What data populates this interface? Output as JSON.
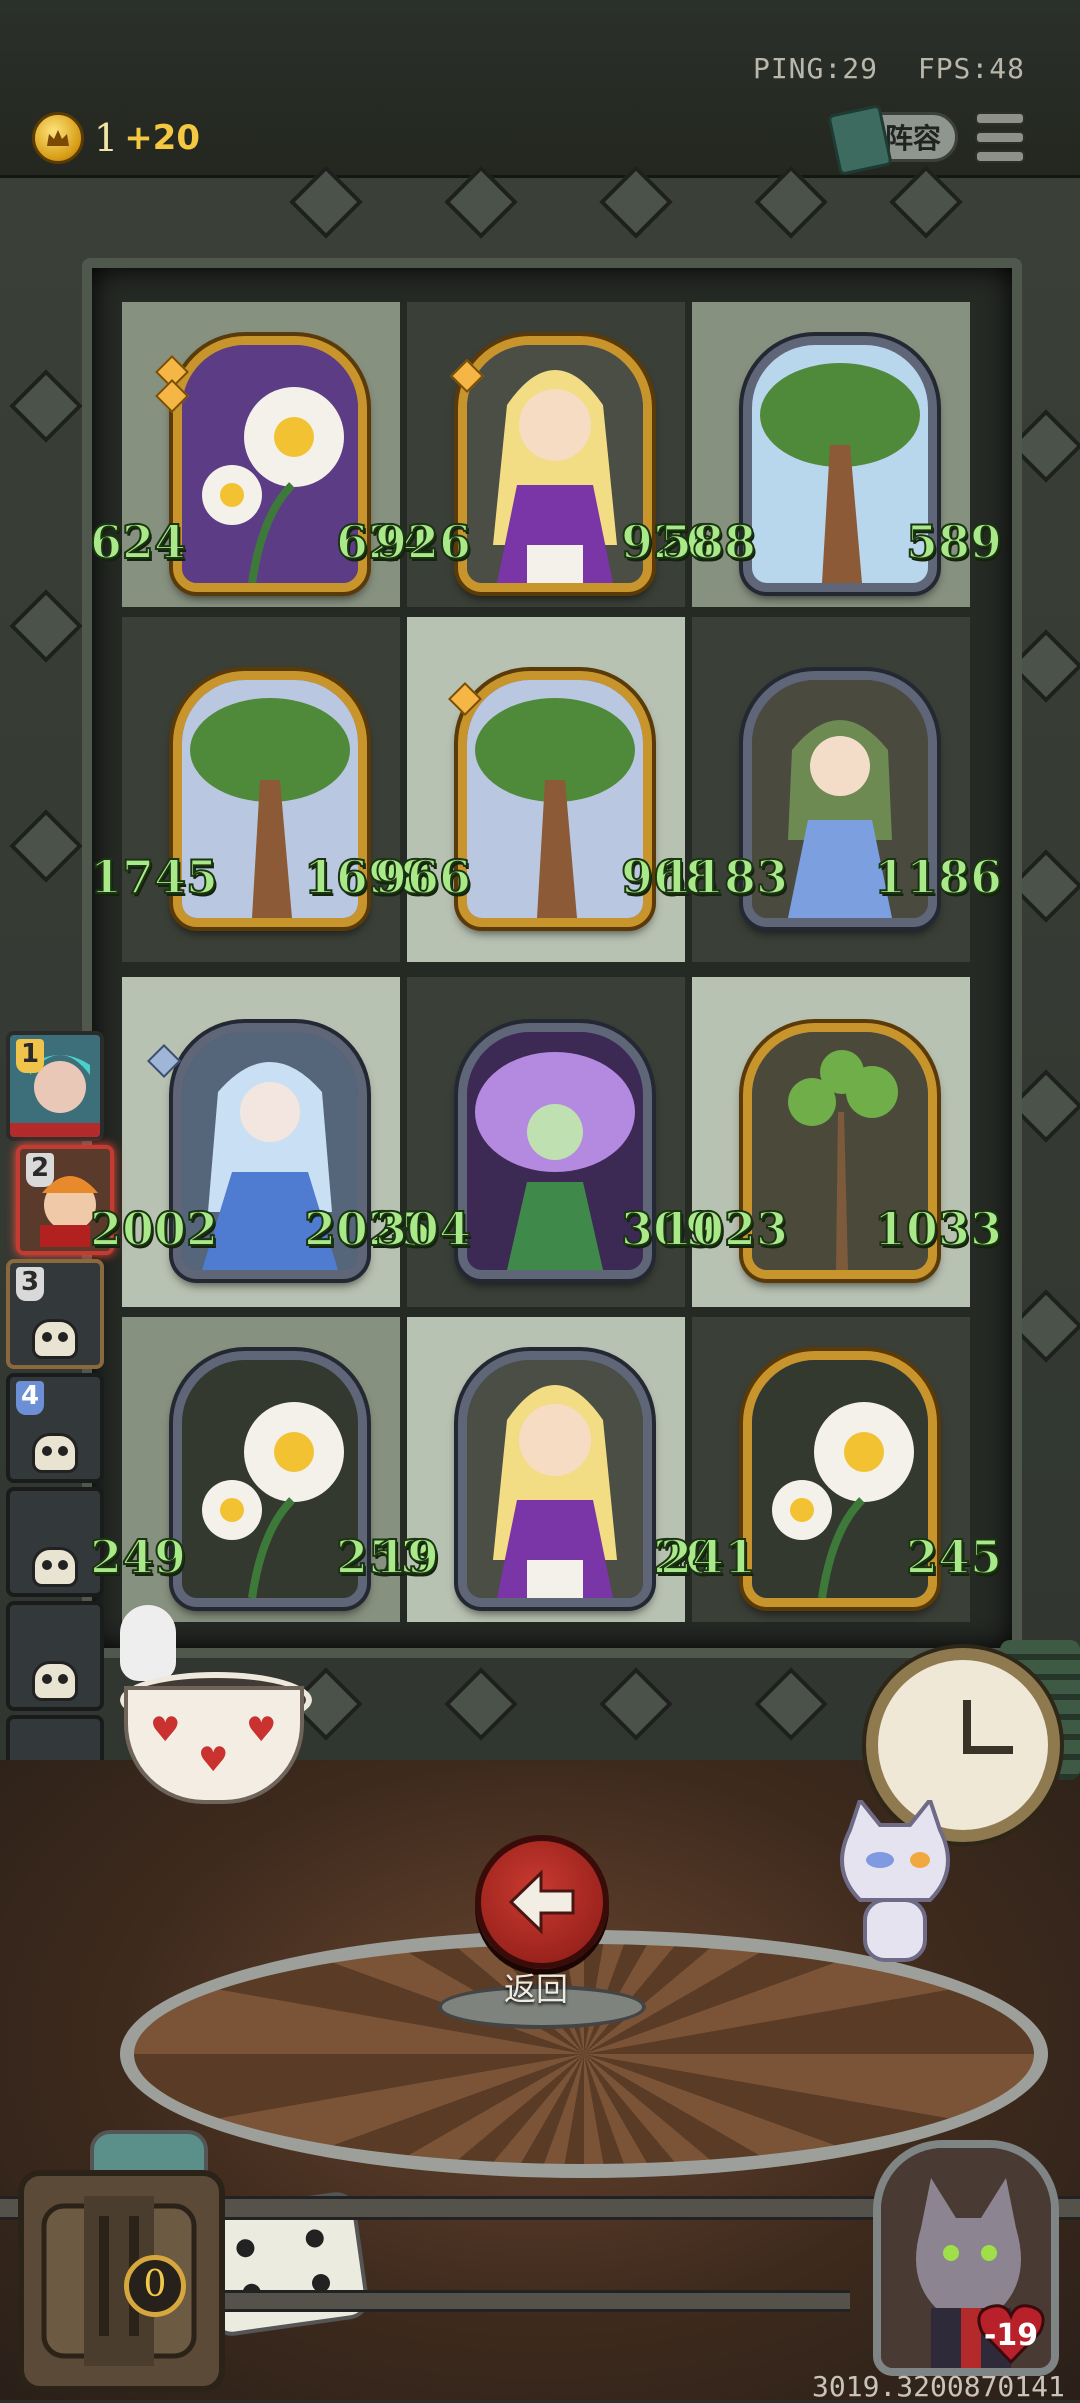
{
  "hud": {
    "ping": "PING:29",
    "fps": "FPS:48",
    "gold_amount": "1",
    "gold_income": "+20",
    "lineup_label": "阵容"
  },
  "board": {
    "cells": [
      {
        "attack": "624",
        "health": "624"
      },
      {
        "attack": "926",
        "health": "926"
      },
      {
        "attack": "588",
        "health": "589"
      },
      {
        "attack": "1745",
        "health": "1698"
      },
      {
        "attack": "966",
        "health": "968"
      },
      {
        "attack": "1183",
        "health": "1186"
      },
      {
        "attack": "2002",
        "health": "2025"
      },
      {
        "attack": "304",
        "health": "309"
      },
      {
        "attack": "1023",
        "health": "1033"
      },
      {
        "attack": "249",
        "health": "253"
      },
      {
        "attack": "19",
        "health": "20"
      },
      {
        "attack": "241",
        "health": "245"
      }
    ]
  },
  "roster": {
    "slots": [
      "1",
      "2",
      "3",
      "4",
      "",
      "",
      "",
      ""
    ]
  },
  "footer": {
    "back_label": "返回",
    "chest_count": "0",
    "player_health": "-19",
    "seed": "3019.3200870141"
  },
  "colors": {
    "stat_green": "#a9e98a",
    "back_red": "#c83a30",
    "gold": "#f5c842"
  }
}
